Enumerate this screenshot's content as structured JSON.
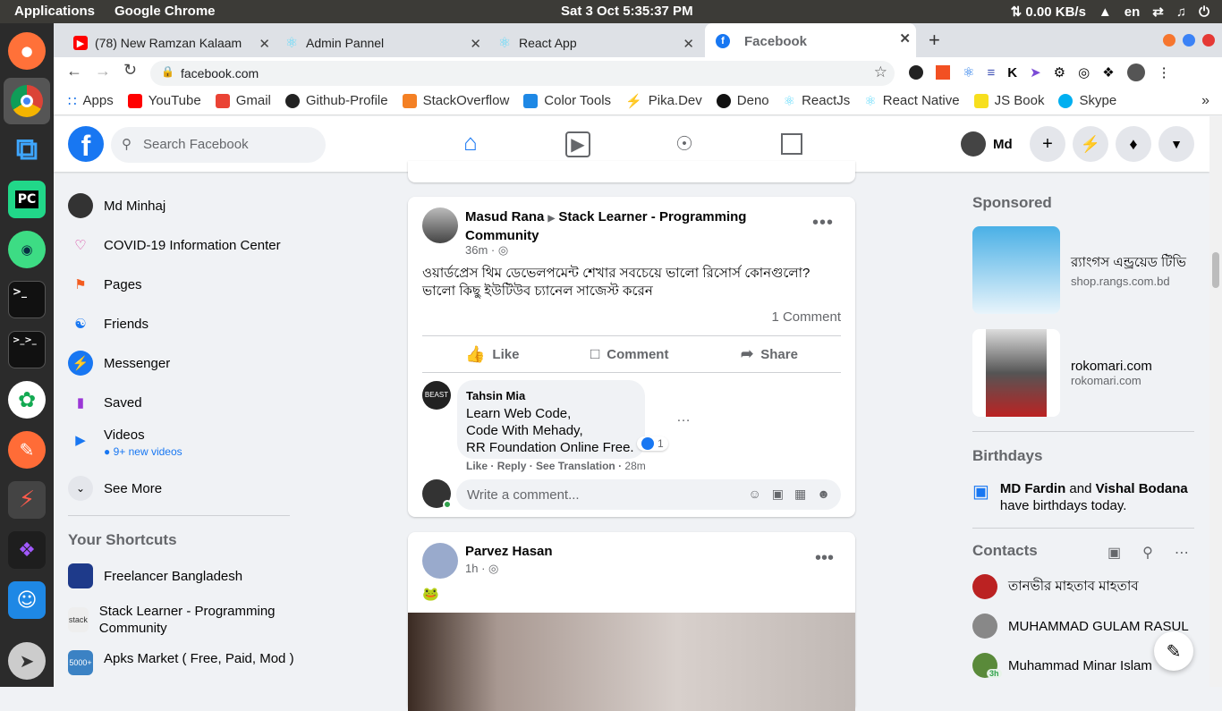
{
  "os": {
    "applications": "Applications",
    "app": "Google Chrome",
    "datetime": "Sat 3 Oct   5:35:37 PM",
    "net": "⇅ 0.00 KB/s",
    "lang": "en"
  },
  "tabs": [
    {
      "title": "(78) New Ramzan Kalaam",
      "color": "#ff0000"
    },
    {
      "title": "Admin Pannel",
      "color": "#61dafb"
    },
    {
      "title": "React App",
      "color": "#61dafb"
    },
    {
      "title": "Facebook",
      "color": "#1877f2"
    }
  ],
  "url": "facebook.com",
  "bookmarks": [
    "Apps",
    "YouTube",
    "Gmail",
    "Github-Profile",
    "StackOverflow",
    "Color Tools",
    "Pika.Dev",
    "Deno",
    "ReactJs",
    "React Native",
    "JS Book",
    "Skype"
  ],
  "fb": {
    "search_placeholder": "Search Facebook",
    "user_short": "Md"
  },
  "left": {
    "items": [
      "Md Minhaj",
      "COVID-19 Information Center",
      "Pages",
      "Friends",
      "Messenger",
      "Saved",
      "Videos"
    ],
    "videos_sub": "9+ new videos",
    "see_more": "See More",
    "shortcuts_title": "Your Shortcuts",
    "shortcuts": [
      "Freelancer Bangladesh",
      "Stack Learner - Programming Community",
      "Apks Market ( Free, Paid, Mod )"
    ]
  },
  "post1": {
    "author": "Masud Rana",
    "group": "Stack Learner - Programming Community",
    "time": "36m",
    "text1": "ওয়ার্ডপ্রেস থিম ডেভেলপমেন্ট শেখার সবচেয়ে ভালো রিসোর্স কোনগুলো?",
    "text2": "ভালো কিছু ইউটিউব চ্যানেল সাজেস্ট করেন",
    "comments": "1 Comment",
    "like": "Like",
    "comment": "Comment",
    "share": "Share",
    "commenter": "Tahsin Mia",
    "c1": "Learn Web Code,",
    "c2": "Code With Mehady,",
    "c3": "RR Foundation Online Free.",
    "reacts": "1",
    "c_like": "Like",
    "c_reply": "Reply",
    "c_trans": "See Translation",
    "c_time": "28m",
    "write": "Write a comment..."
  },
  "post2": {
    "author": "Parvez Hasan",
    "time": "1h",
    "emoji": "🐸"
  },
  "right": {
    "sponsored": "Sponsored",
    "ads": [
      {
        "title": "র‍্যাংগস এন্ড্রয়েড টিভি",
        "site": "shop.rangs.com.bd"
      },
      {
        "title": "rokomari.com",
        "site": "rokomari.com"
      }
    ],
    "birthdays": "Birthdays",
    "bday_a": "MD Fardin",
    "bday_and": " and ",
    "bday_b": "Vishal Bodana",
    "bday_rest": "have birthdays today.",
    "contacts": "Contacts",
    "contact_list": [
      "তানভীর মাহতাব মাহতাব",
      "MUHAMMAD GULAM RASUL",
      "Muhammad Minar Islam"
    ],
    "minar_badge": "3h"
  }
}
